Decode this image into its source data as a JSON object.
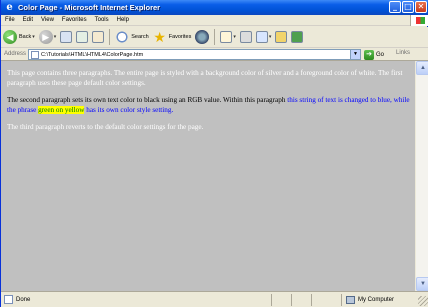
{
  "window": {
    "title": "Color Page - Microsoft Internet Explorer",
    "app_icon": "ie-icon",
    "controls": {
      "minimize": "_",
      "maximize": "□",
      "close": "✕"
    }
  },
  "menu": [
    "File",
    "Edit",
    "View",
    "Favorites",
    "Tools",
    "Help"
  ],
  "toolbar": {
    "back_label": "Back",
    "search_label": "Search",
    "favorites_label": "Favorites"
  },
  "address": {
    "label": "Address",
    "url": "C:\\Tutorials\\HTML\\HTML4\\ColorPage.htm",
    "go_label": "Go",
    "links_label": "Links"
  },
  "content": {
    "background_color": "#c0c0c0",
    "p1": "This page contains three paragraphs. The entire page is styled with a background color of silver and a foreground color of white. The first paragraph uses these page default color settings.",
    "p2_start": "The second paragraph sets its own text color to black using an RGB value. Within this paragraph ",
    "p2_blue": "this string of text is changed to blue, while the phrase ",
    "p2_highlight": "green on yellow",
    "p2_end": " has its own color style setting.",
    "p3": "The third paragraph reverts to the default color settings for the page."
  },
  "status": {
    "text": "Done",
    "zone": "My Computer"
  }
}
